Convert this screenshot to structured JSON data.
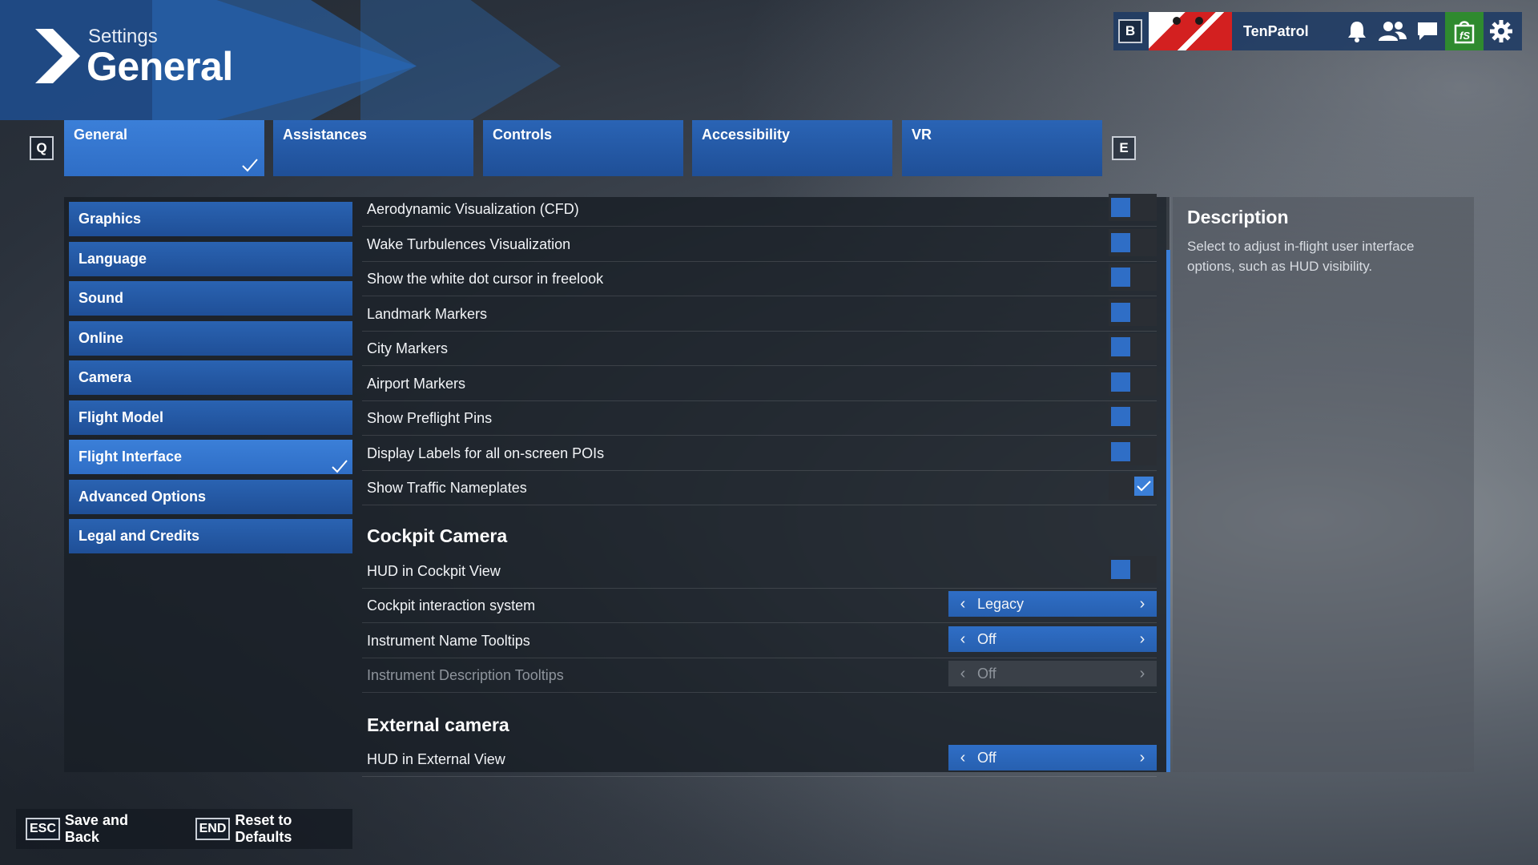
{
  "header": {
    "small_title": "Settings",
    "big_title": "General"
  },
  "topbar": {
    "left_key": "B",
    "username": "TenPatrol",
    "icons": [
      "bell-icon",
      "friends-icon",
      "chat-icon",
      "store-icon",
      "gear-icon"
    ],
    "store_label": "fS"
  },
  "tabs": {
    "prev_key": "Q",
    "next_key": "E",
    "items": [
      {
        "label": "General",
        "active": true
      },
      {
        "label": "Assistances"
      },
      {
        "label": "Controls"
      },
      {
        "label": "Accessibility"
      },
      {
        "label": "VR"
      }
    ]
  },
  "categories": [
    {
      "label": "Graphics"
    },
    {
      "label": "Language"
    },
    {
      "label": "Sound"
    },
    {
      "label": "Online"
    },
    {
      "label": "Camera"
    },
    {
      "label": "Flight Model"
    },
    {
      "label": "Flight Interface",
      "active": true
    },
    {
      "label": "Advanced Options"
    },
    {
      "label": "Legal and Credits"
    }
  ],
  "settings": [
    {
      "label": "Aerodynamic Visualization (CFD)",
      "type": "toggle",
      "value": "off"
    },
    {
      "label": "Wake Turbulences Visualization",
      "type": "toggle",
      "value": "off"
    },
    {
      "label": "Show the white dot cursor in freelook",
      "type": "toggle",
      "value": "off"
    },
    {
      "label": "Landmark Markers",
      "type": "toggle",
      "value": "off"
    },
    {
      "label": "City Markers",
      "type": "toggle",
      "value": "off"
    },
    {
      "label": "Airport Markers",
      "type": "toggle",
      "value": "off"
    },
    {
      "label": "Show Preflight Pins",
      "type": "toggle",
      "value": "off"
    },
    {
      "label": "Display Labels for all on-screen POIs",
      "type": "toggle",
      "value": "off"
    },
    {
      "label": "Show Traffic Nameplates",
      "type": "toggle",
      "value": "on"
    }
  ],
  "cockpit_camera": {
    "title": "Cockpit Camera",
    "settings": [
      {
        "label": "HUD in Cockpit View",
        "type": "toggle",
        "value": "off"
      },
      {
        "label": "Cockpit interaction system",
        "type": "selector",
        "value": "Legacy"
      },
      {
        "label": "Instrument Name Tooltips",
        "type": "selector",
        "value": "Off"
      },
      {
        "label": "Instrument Description Tooltips",
        "type": "selector",
        "value": "Off",
        "disabled": true
      }
    ]
  },
  "external_camera": {
    "title": "External camera",
    "settings": [
      {
        "label": "HUD in External View",
        "type": "selector",
        "value": "Off"
      }
    ]
  },
  "description": {
    "title": "Description",
    "text": "Select to adjust in-flight user interface options, such as HUD visibility."
  },
  "bottom": {
    "save_key": "ESC",
    "save_label": "Save and Back",
    "reset_key": "END",
    "reset_label": "Reset to Defaults"
  },
  "colors": {
    "accent": "#2f6ec6",
    "tab": "#1f4f97",
    "store": "#2f8a2f"
  }
}
